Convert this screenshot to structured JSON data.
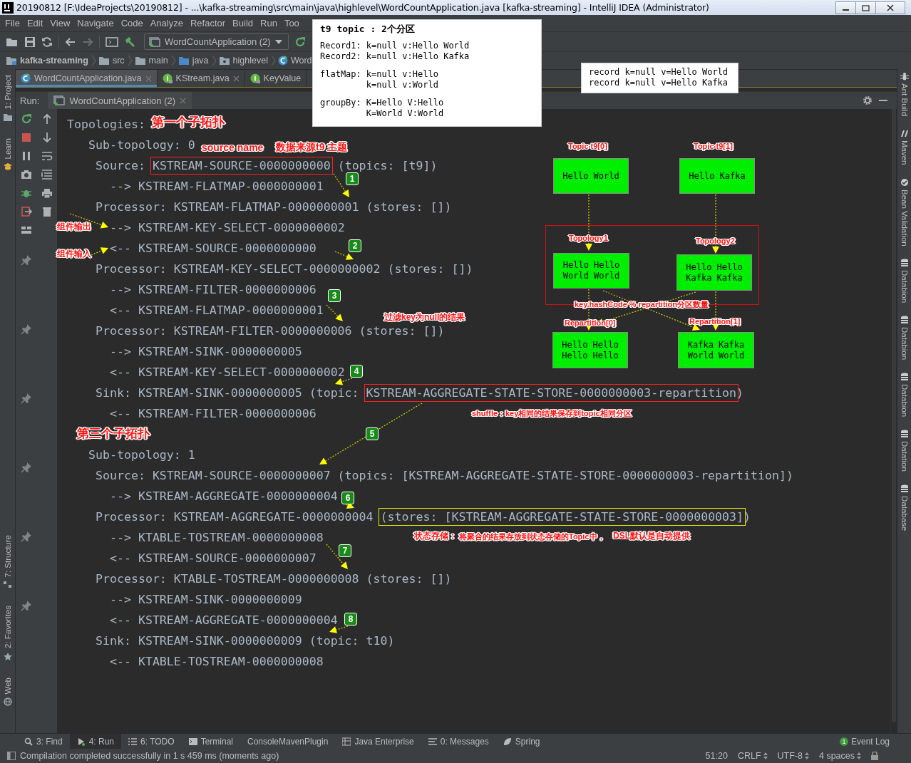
{
  "window": {
    "title": "20190812 [F:\\IdeaProjects\\20190812] - ...\\kafka-streaming\\src\\main\\java\\highlevel\\WordCountApplication.java [kafka-streaming] - IntelliJ IDEA (Administrator)"
  },
  "menu": [
    "File",
    "Edit",
    "View",
    "Navigate",
    "Code",
    "Analyze",
    "Refactor",
    "Build",
    "Run",
    "Too"
  ],
  "toolbar": {
    "run_config": "WordCountApplication (2)"
  },
  "breadcrumb": [
    {
      "label": "kafka-streaming",
      "kind": "module"
    },
    {
      "label": "src",
      "kind": "folder"
    },
    {
      "label": "main",
      "kind": "folder"
    },
    {
      "label": "java",
      "kind": "source"
    },
    {
      "label": "highlevel",
      "kind": "package"
    },
    {
      "label": "Word",
      "kind": "class"
    }
  ],
  "editor_tabs": [
    {
      "label": "WordCountApplication.java",
      "kind": "class",
      "selected": true,
      "closable": true
    },
    {
      "label": "KStream.java",
      "kind": "interface",
      "selected": false,
      "closable": true
    },
    {
      "label": "KeyValue",
      "kind": "interface",
      "selected": false,
      "closable": false
    }
  ],
  "run_panel": {
    "label": "Run:",
    "tab": "WordCountApplication (2)"
  },
  "left_strip": [
    {
      "label": "1: Project",
      "kind": "top"
    },
    {
      "label": "Learn",
      "kind": "top"
    },
    {
      "label": "7: Structure",
      "kind": "bottom"
    },
    {
      "label": "2: Favorites",
      "kind": "bottom"
    },
    {
      "label": "Web",
      "kind": "bottom"
    }
  ],
  "right_strip": [
    {
      "label": "Ant Build",
      "kind": "ant"
    },
    {
      "label": "Maven",
      "kind": "maven"
    },
    {
      "label": "Bean Validation",
      "kind": "bean"
    },
    {
      "label": "Databion",
      "kind": "db"
    },
    {
      "label": "Databion",
      "kind": "db"
    },
    {
      "label": "Databion",
      "kind": "db"
    },
    {
      "label": "Datation",
      "kind": "db"
    },
    {
      "label": "Database",
      "kind": "db"
    }
  ],
  "console": {
    "lines": [
      {
        "kind": "heading",
        "text": "Topologies:"
      },
      {
        "kind": "subtopology",
        "text": "Sub-topology: 0"
      },
      {
        "kind": "node",
        "parts": [
          {
            "text": "Source: "
          },
          {
            "text": "KSTREAM-SOURCE-0000000000",
            "color": "#ff1f1f"
          },
          {
            "text": " (topics: [t9])"
          }
        ]
      },
      {
        "kind": "edge",
        "text": "--> KSTREAM-FLATMAP-0000000001"
      },
      {
        "kind": "node",
        "text": "Processor: KSTREAM-FLATMAP-0000000001 (stores: [])"
      },
      {
        "kind": "edge",
        "text": "--> KSTREAM-KEY-SELECT-0000000002"
      },
      {
        "kind": "edge",
        "text": "<-- KSTREAM-SOURCE-0000000000"
      },
      {
        "kind": "node",
        "text": "Processor: KSTREAM-KEY-SELECT-0000000002 (stores: [])"
      },
      {
        "kind": "edge",
        "text": "--> KSTREAM-FILTER-0000000006"
      },
      {
        "kind": "edge",
        "text": "<-- KSTREAM-FLATMAP-0000000001"
      },
      {
        "kind": "node",
        "text": "Processor: KSTREAM-FILTER-0000000006 (stores: [])"
      },
      {
        "kind": "edge",
        "text": "--> KSTREAM-SINK-0000000005"
      },
      {
        "kind": "edge",
        "text": "<-- KSTREAM-KEY-SELECT-0000000002"
      },
      {
        "kind": "node",
        "parts": [
          {
            "text": "Sink: KSTREAM-SINK-0000000005 (topic: "
          },
          {
            "text": "KSTREAM-AGGREGATE-STATE-STORE-0000000003-repartition",
            "color": "#ff1f1f"
          },
          {
            "text": ")"
          }
        ]
      },
      {
        "kind": "edge",
        "text": "<-- KSTREAM-FILTER-0000000006"
      },
      {
        "kind": "blank"
      },
      {
        "kind": "subtopology",
        "text": "Sub-topology: 1"
      },
      {
        "kind": "node",
        "text": "Source: KSTREAM-SOURCE-0000000007 (topics: [KSTREAM-AGGREGATE-STATE-STORE-0000000003-repartition])"
      },
      {
        "kind": "edge",
        "text": "--> KSTREAM-AGGREGATE-0000000004"
      },
      {
        "kind": "node",
        "parts": [
          {
            "text": "Processor: KSTREAM-AGGREGATE-0000000004 "
          },
          {
            "text": "(stores: [KSTREAM-AGGREGATE-STATE-STORE-0000000003]",
            "color": "#e8e800"
          },
          {
            "text": ")"
          }
        ]
      },
      {
        "kind": "edge",
        "text": "--> KTABLE-TOSTREAM-0000000008"
      },
      {
        "kind": "edge",
        "text": "<-- KSTREAM-SOURCE-0000000007"
      },
      {
        "kind": "node",
        "text": "Processor: KTABLE-TOSTREAM-0000000008 (stores: [])"
      },
      {
        "kind": "edge",
        "text": "--> KSTREAM-SINK-0000000009"
      },
      {
        "kind": "edge",
        "text": "<-- KSTREAM-AGGREGATE-0000000004"
      },
      {
        "kind": "node",
        "text": "Sink: KSTREAM-SINK-0000000009 (topic: t10)"
      },
      {
        "kind": "edge",
        "text": "<-- KTABLE-TOSTREAM-0000000008"
      }
    ]
  },
  "annotations": [
    "第一个子拓扑",
    "source name",
    "数据来源t9 主题",
    "组件输出",
    "组件输入",
    "过滤key为null的结果",
    "shuffle：",
    "key相同的结果保存到topic相同分区",
    "第三个子拓扑",
    "状态存储：",
    "将聚合的结果存放到状态存储的Topic中，",
    "DSL默认是自动提供"
  ],
  "steps": [
    "1",
    "2",
    "3",
    "4",
    "5",
    "6",
    "7",
    "8"
  ],
  "diagram": {
    "labels": [
      "Topic t9[0]",
      "Topic t9[1]",
      "Topology1",
      "Topology2",
      "key.hashCode % repartition分区数量",
      "Repartition[0]",
      "Repartition[1]"
    ],
    "boxes": [
      {
        "lines": [
          "Hello World"
        ]
      },
      {
        "lines": [
          "Hello Kafka"
        ]
      },
      {
        "lines": [
          "Hello Hello",
          "World World"
        ]
      },
      {
        "lines": [
          "Hello Hello",
          "Kafka Kafka"
        ]
      },
      {
        "lines": [
          "Hello Hello",
          "Hello Hello"
        ]
      },
      {
        "lines": [
          "Kafka Kafka",
          "World World"
        ]
      }
    ]
  },
  "notes": [
    {
      "title": "t9 topic : 2个分区",
      "sections": [
        {
          "entries": [
            {
              "label": "Record1:",
              "values": [
                "k=null v:Hello World"
              ]
            },
            {
              "label": "Record2:",
              "values": [
                "k=null v:Hello Kafka"
              ]
            }
          ]
        },
        {
          "entries": [
            {
              "label": "flatMap:",
              "values": [
                "k=null v:Hello",
                "k=null v:World"
              ]
            }
          ]
        },
        {
          "entries": [
            {
              "label": "groupBy:",
              "values": [
                "K=Hello V:Hello",
                "K=World V:World"
              ]
            }
          ]
        }
      ]
    },
    {
      "lines": [
        "record k=null v=Hello World",
        "record k=null v=Hello Kafka"
      ]
    }
  ],
  "bottom_tools": [
    {
      "label": "3: Find",
      "kind": "find",
      "selected": false
    },
    {
      "label": "4: Run",
      "kind": "run",
      "selected": true
    },
    {
      "label": "6: TODO",
      "kind": "todo",
      "selected": false
    },
    {
      "label": "Terminal",
      "kind": "terminal",
      "selected": false
    },
    {
      "label": "ConsoleMavenPlugin",
      "kind": "plain",
      "selected": false
    },
    {
      "label": "Java Enterprise",
      "kind": "enterprise",
      "selected": false
    },
    {
      "label": "0: Messages",
      "kind": "messages",
      "selected": false
    },
    {
      "label": "Spring",
      "kind": "spring",
      "selected": false
    }
  ],
  "event_log": {
    "label": "Event Log",
    "count": "1"
  },
  "status_bar": {
    "message": "Compilation completed successfully in 1 s 459 ms (moments ago)",
    "position": "51:20",
    "line_separator": "CRLF",
    "encoding": "UTF-8",
    "indent": "4 spaces"
  }
}
